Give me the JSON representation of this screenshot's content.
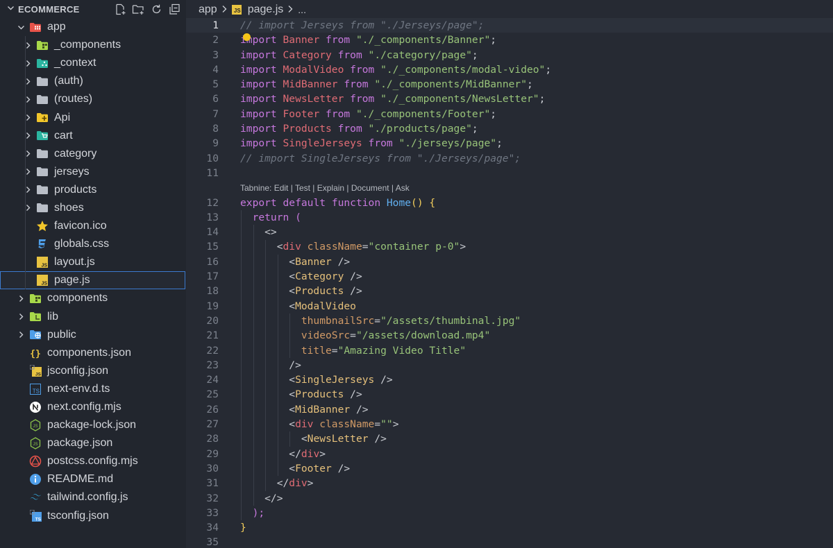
{
  "explorer": {
    "title": "ECOMMERCE",
    "actions": [
      "new-file-icon",
      "new-folder-icon",
      "refresh-icon",
      "collapse-all-icon"
    ],
    "items": [
      {
        "label": "app",
        "depth": 0,
        "type": "folder",
        "open": true,
        "icon": "folder-app-icon",
        "color": "#e8534a"
      },
      {
        "label": "_components",
        "depth": 1,
        "type": "folder",
        "open": false,
        "icon": "folder-components-icon",
        "color": "#a8d94a"
      },
      {
        "label": "_context",
        "depth": 1,
        "type": "folder",
        "open": false,
        "icon": "folder-context-icon",
        "color": "#2bb5a0"
      },
      {
        "label": "(auth)",
        "depth": 1,
        "type": "folder",
        "open": false,
        "icon": "folder-icon",
        "color": "#b9bec7"
      },
      {
        "label": "(routes)",
        "depth": 1,
        "type": "folder",
        "open": false,
        "icon": "folder-icon",
        "color": "#b9bec7"
      },
      {
        "label": "Api",
        "depth": 1,
        "type": "folder",
        "open": false,
        "icon": "folder-api-icon",
        "color": "#f2c62b"
      },
      {
        "label": "cart",
        "depth": 1,
        "type": "folder",
        "open": false,
        "icon": "folder-cart-icon",
        "color": "#2bb5a0"
      },
      {
        "label": "category",
        "depth": 1,
        "type": "folder",
        "open": false,
        "icon": "folder-icon",
        "color": "#b9bec7"
      },
      {
        "label": "jerseys",
        "depth": 1,
        "type": "folder",
        "open": false,
        "icon": "folder-icon",
        "color": "#b9bec7"
      },
      {
        "label": "products",
        "depth": 1,
        "type": "folder",
        "open": false,
        "icon": "folder-icon",
        "color": "#b9bec7"
      },
      {
        "label": "shoes",
        "depth": 1,
        "type": "folder",
        "open": false,
        "icon": "folder-icon",
        "color": "#b9bec7"
      },
      {
        "label": "favicon.ico",
        "depth": 1,
        "type": "file",
        "icon": "star-icon",
        "color": "#f2c62b"
      },
      {
        "label": "globals.css",
        "depth": 1,
        "type": "file",
        "icon": "css-icon",
        "color": "#4f9ee8"
      },
      {
        "label": "layout.js",
        "depth": 1,
        "type": "file",
        "icon": "js-icon",
        "color": "#e8c341"
      },
      {
        "label": "page.js",
        "depth": 1,
        "type": "file",
        "icon": "js-icon",
        "color": "#e8c341",
        "selected": true
      },
      {
        "label": "components",
        "depth": 0,
        "type": "folder",
        "open": false,
        "icon": "folder-components-icon",
        "color": "#a8d94a"
      },
      {
        "label": "lib",
        "depth": 0,
        "type": "folder",
        "open": false,
        "icon": "folder-lib-icon",
        "color": "#a8d94a"
      },
      {
        "label": "public",
        "depth": 0,
        "type": "folder",
        "open": false,
        "icon": "folder-public-icon",
        "color": "#4f9ee8"
      },
      {
        "label": "components.json",
        "depth": 0,
        "type": "file",
        "icon": "json-icon",
        "color": "#e8c341"
      },
      {
        "label": "jsconfig.json",
        "depth": 0,
        "type": "file",
        "icon": "jsconfig-icon",
        "color": "#e8c341"
      },
      {
        "label": "next-env.d.ts",
        "depth": 0,
        "type": "file",
        "icon": "ts-icon",
        "color": "#4f9ee8"
      },
      {
        "label": "next.config.mjs",
        "depth": 0,
        "type": "file",
        "icon": "next-icon",
        "color": "#ffffff"
      },
      {
        "label": "package-lock.json",
        "depth": 0,
        "type": "file",
        "icon": "nodejs-icon",
        "color": "#8bc34a"
      },
      {
        "label": "package.json",
        "depth": 0,
        "type": "file",
        "icon": "nodejs-icon",
        "color": "#8bc34a"
      },
      {
        "label": "postcss.config.mjs",
        "depth": 0,
        "type": "file",
        "icon": "postcss-icon",
        "color": "#e8534a"
      },
      {
        "label": "README.md",
        "depth": 0,
        "type": "file",
        "icon": "info-icon",
        "color": "#4f9ee8"
      },
      {
        "label": "tailwind.config.js",
        "depth": 0,
        "type": "file",
        "icon": "tailwind-icon",
        "color": "#38bdf8"
      },
      {
        "label": "tsconfig.json",
        "depth": 0,
        "type": "file",
        "icon": "tsconfig-icon",
        "color": "#4f9ee8"
      }
    ]
  },
  "breadcrumb": {
    "folder": "app",
    "file": "page.js",
    "badge": "JS",
    "more": "..."
  },
  "codelens": "Tabnine: Edit | Test | Explain | Document | Ask",
  "codelens_after_line": 11,
  "current_line": 1,
  "lines": [
    {
      "n": "1",
      "t": [
        [
          "// import Jerseys from \"./Jerseys/page\";",
          "cm"
        ]
      ]
    },
    {
      "n": "2",
      "t": [
        [
          "import ",
          "kw"
        ],
        [
          "Banner ",
          "id"
        ],
        [
          "from ",
          "kw"
        ],
        [
          "\"./_components/Banner\"",
          "st"
        ],
        [
          ";",
          "pl"
        ]
      ]
    },
    {
      "n": "3",
      "t": [
        [
          "import ",
          "kw"
        ],
        [
          "Category ",
          "id"
        ],
        [
          "from ",
          "kw"
        ],
        [
          "\"./category/page\"",
          "st"
        ],
        [
          ";",
          "pl"
        ]
      ]
    },
    {
      "n": "4",
      "t": [
        [
          "import ",
          "kw"
        ],
        [
          "ModalVideo ",
          "id"
        ],
        [
          "from ",
          "kw"
        ],
        [
          "\"./_components/modal-video\"",
          "st"
        ],
        [
          ";",
          "pl"
        ]
      ]
    },
    {
      "n": "5",
      "t": [
        [
          "import ",
          "kw"
        ],
        [
          "MidBanner ",
          "id"
        ],
        [
          "from ",
          "kw"
        ],
        [
          "\"./_components/MidBanner\"",
          "st"
        ],
        [
          ";",
          "pl"
        ]
      ]
    },
    {
      "n": "6",
      "t": [
        [
          "import ",
          "kw"
        ],
        [
          "NewsLetter ",
          "id"
        ],
        [
          "from ",
          "kw"
        ],
        [
          "\"./_components/NewsLetter\"",
          "st"
        ],
        [
          ";",
          "pl"
        ]
      ]
    },
    {
      "n": "7",
      "t": [
        [
          "import ",
          "kw"
        ],
        [
          "Footer ",
          "id"
        ],
        [
          "from ",
          "kw"
        ],
        [
          "\"./_components/Footer\"",
          "st"
        ],
        [
          ";",
          "pl"
        ]
      ]
    },
    {
      "n": "8",
      "t": [
        [
          "import ",
          "kw"
        ],
        [
          "Products ",
          "id"
        ],
        [
          "from ",
          "kw"
        ],
        [
          "\"./products/page\"",
          "st"
        ],
        [
          ";",
          "pl"
        ]
      ]
    },
    {
      "n": "9",
      "t": [
        [
          "import ",
          "kw"
        ],
        [
          "SingleJerseys ",
          "id"
        ],
        [
          "from ",
          "kw"
        ],
        [
          "\"./jerseys/page\"",
          "st"
        ],
        [
          ";",
          "pl"
        ]
      ]
    },
    {
      "n": "10",
      "t": [
        [
          "// import SingleJerseys from \"./Jerseys/page\";",
          "cm"
        ]
      ]
    },
    {
      "n": "11",
      "t": []
    },
    {
      "n": "12",
      "t": [
        [
          "export ",
          "kw"
        ],
        [
          "default ",
          "kw"
        ],
        [
          "function ",
          "kw"
        ],
        [
          "Home",
          "fn"
        ],
        [
          "() ",
          "pu"
        ],
        [
          "{",
          "pu"
        ]
      ]
    },
    {
      "n": "13",
      "t": [
        [
          "  return ",
          "kw"
        ],
        [
          "(",
          "kw"
        ]
      ]
    },
    {
      "n": "14",
      "t": [
        [
          "    <>",
          "tg"
        ]
      ]
    },
    {
      "n": "15",
      "t": [
        [
          "      <",
          "tg"
        ],
        [
          "div ",
          "rd"
        ],
        [
          "className",
          "at"
        ],
        [
          "=",
          "pl"
        ],
        [
          "\"container p-0\"",
          "st"
        ],
        [
          ">",
          "tg"
        ]
      ]
    },
    {
      "n": "16",
      "t": [
        [
          "        <",
          "tg"
        ],
        [
          "Banner",
          "jx"
        ],
        [
          " />",
          "tg"
        ]
      ]
    },
    {
      "n": "17",
      "t": [
        [
          "        <",
          "tg"
        ],
        [
          "Category",
          "jx"
        ],
        [
          " />",
          "tg"
        ]
      ]
    },
    {
      "n": "18",
      "t": [
        [
          "        <",
          "tg"
        ],
        [
          "Products",
          "jx"
        ],
        [
          " />",
          "tg"
        ]
      ]
    },
    {
      "n": "19",
      "t": [
        [
          "        <",
          "tg"
        ],
        [
          "ModalVideo",
          "jx"
        ]
      ]
    },
    {
      "n": "20",
      "t": [
        [
          "          thumbnailSrc",
          "at"
        ],
        [
          "=",
          "pl"
        ],
        [
          "\"/assets/thumbinal.jpg\"",
          "st"
        ]
      ]
    },
    {
      "n": "21",
      "t": [
        [
          "          videoSrc",
          "at"
        ],
        [
          "=",
          "pl"
        ],
        [
          "\"/assets/download.mp4\"",
          "st"
        ]
      ]
    },
    {
      "n": "22",
      "t": [
        [
          "          title",
          "at"
        ],
        [
          "=",
          "pl"
        ],
        [
          "\"Amazing Video Title\"",
          "st"
        ]
      ]
    },
    {
      "n": "23",
      "t": [
        [
          "        />",
          "tg"
        ]
      ]
    },
    {
      "n": "24",
      "t": [
        [
          "        <",
          "tg"
        ],
        [
          "SingleJerseys",
          "jx"
        ],
        [
          " />",
          "tg"
        ]
      ]
    },
    {
      "n": "25",
      "t": [
        [
          "        <",
          "tg"
        ],
        [
          "Products",
          "jx"
        ],
        [
          " />",
          "tg"
        ]
      ]
    },
    {
      "n": "26",
      "t": [
        [
          "        <",
          "tg"
        ],
        [
          "MidBanner",
          "jx"
        ],
        [
          " />",
          "tg"
        ]
      ]
    },
    {
      "n": "27",
      "t": [
        [
          "        <",
          "tg"
        ],
        [
          "div ",
          "rd"
        ],
        [
          "className",
          "at"
        ],
        [
          "=",
          "pl"
        ],
        [
          "\"\"",
          "st"
        ],
        [
          ">",
          "tg"
        ]
      ]
    },
    {
      "n": "28",
      "t": [
        [
          "          <",
          "tg"
        ],
        [
          "NewsLetter",
          "jx"
        ],
        [
          " />",
          "tg"
        ]
      ]
    },
    {
      "n": "29",
      "t": [
        [
          "        </",
          "tg"
        ],
        [
          "div",
          "rd"
        ],
        [
          ">",
          "tg"
        ]
      ]
    },
    {
      "n": "30",
      "t": [
        [
          "        <",
          "tg"
        ],
        [
          "Footer",
          "jx"
        ],
        [
          " />",
          "tg"
        ]
      ]
    },
    {
      "n": "31",
      "t": [
        [
          "      </",
          "tg"
        ],
        [
          "div",
          "rd"
        ],
        [
          ">",
          "tg"
        ]
      ]
    },
    {
      "n": "32",
      "t": [
        [
          "    </>",
          "tg"
        ]
      ]
    },
    {
      "n": "33",
      "t": [
        [
          "  );",
          "kw"
        ]
      ]
    },
    {
      "n": "34",
      "t": [
        [
          "}",
          "pu"
        ]
      ]
    },
    {
      "n": "35",
      "t": []
    }
  ]
}
